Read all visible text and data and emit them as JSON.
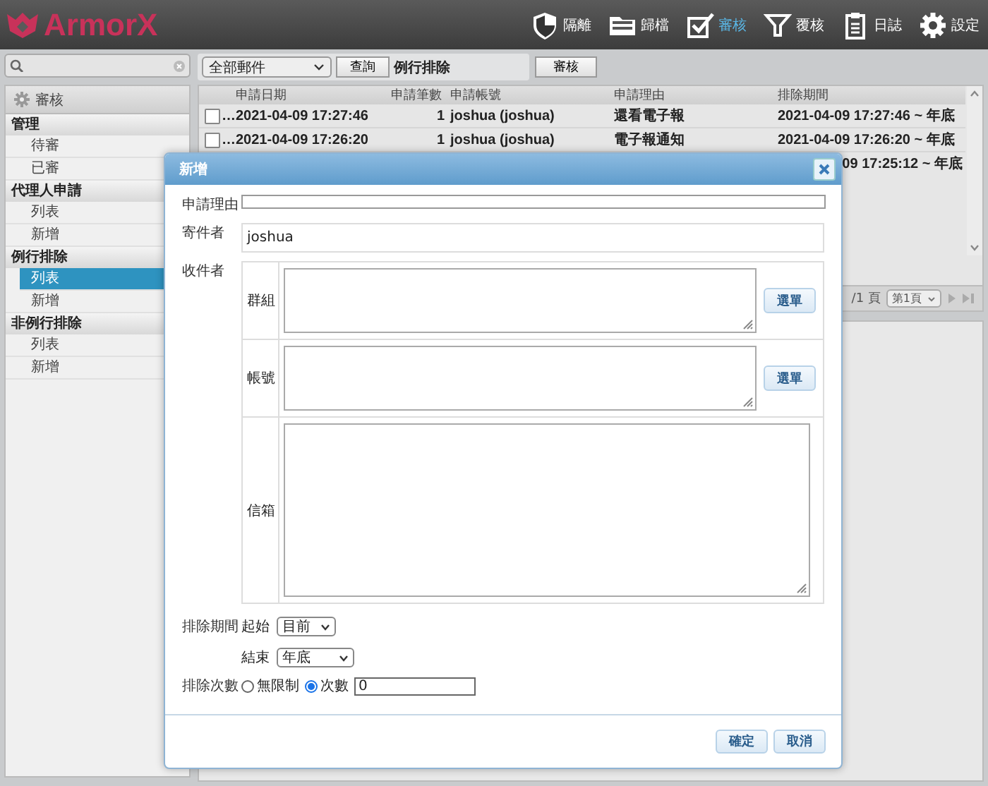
{
  "header": {
    "logo": "ArmorX",
    "nav": [
      {
        "label": "隔離",
        "selected": false
      },
      {
        "label": "歸檔",
        "selected": false
      },
      {
        "label": "審核",
        "selected": true
      },
      {
        "label": "覆核",
        "selected": false
      },
      {
        "label": "日誌",
        "selected": false
      },
      {
        "label": "設定",
        "selected": false
      }
    ]
  },
  "toolbar": {
    "mail_filter": "全部郵件",
    "query_button": "查詢",
    "section_title": "例行排除",
    "review_button": "審核"
  },
  "sidebar": {
    "title": "審核",
    "groups": [
      {
        "label": "管理",
        "items": [
          {
            "label": "待審",
            "selected": false
          },
          {
            "label": "已審",
            "selected": false
          }
        ]
      },
      {
        "label": "代理人申請",
        "items": [
          {
            "label": "列表",
            "selected": false
          },
          {
            "label": "新增",
            "selected": false
          }
        ]
      },
      {
        "label": "例行排除",
        "items": [
          {
            "label": "列表",
            "selected": true
          },
          {
            "label": "新增",
            "selected": false
          }
        ]
      },
      {
        "label": "非例行排除",
        "items": [
          {
            "label": "列表",
            "selected": false
          },
          {
            "label": "新增",
            "selected": false
          }
        ]
      }
    ]
  },
  "table": {
    "columns": [
      "申請日期",
      "申請筆數",
      "申請帳號",
      "申請理由",
      "排除期間"
    ],
    "rows": [
      {
        "checked": false,
        "mark": "…",
        "cells": [
          "2021-04-09 17:27:46",
          "1",
          "joshua (joshua)",
          "還看電子報",
          "2021-04-09 17:27:46 ~ 年底"
        ]
      },
      {
        "checked": false,
        "mark": "…",
        "cells": [
          "2021-04-09 17:26:20",
          "1",
          "joshua (joshua)",
          "電子報通知",
          "2021-04-09 17:26:20 ~ 年底"
        ]
      }
    ],
    "partial_row": {
      "period": "09 17:25:12 ~ 年底"
    }
  },
  "pager": {
    "page_count": "/1 頁",
    "page_select": "第1頁"
  },
  "dialog": {
    "title": "新增",
    "reason_label": "申請理由",
    "sender": {
      "label": "寄件者",
      "value": "joshua"
    },
    "recipients": {
      "label": "收件者",
      "rows": [
        {
          "label": "群組",
          "button": "選單"
        },
        {
          "label": "帳號",
          "button": "選單"
        },
        {
          "label": "信箱"
        }
      ]
    },
    "period": {
      "label": "排除期間",
      "start": {
        "label": "起始",
        "value": "目前"
      },
      "end": {
        "label": "結束",
        "value": "年底"
      }
    },
    "count": {
      "label": "排除次數",
      "options": [
        {
          "label": "無限制",
          "selected": false
        },
        {
          "label": "次數",
          "selected": true
        }
      ],
      "value": "0"
    },
    "buttons": [
      "確定",
      "取消"
    ]
  }
}
